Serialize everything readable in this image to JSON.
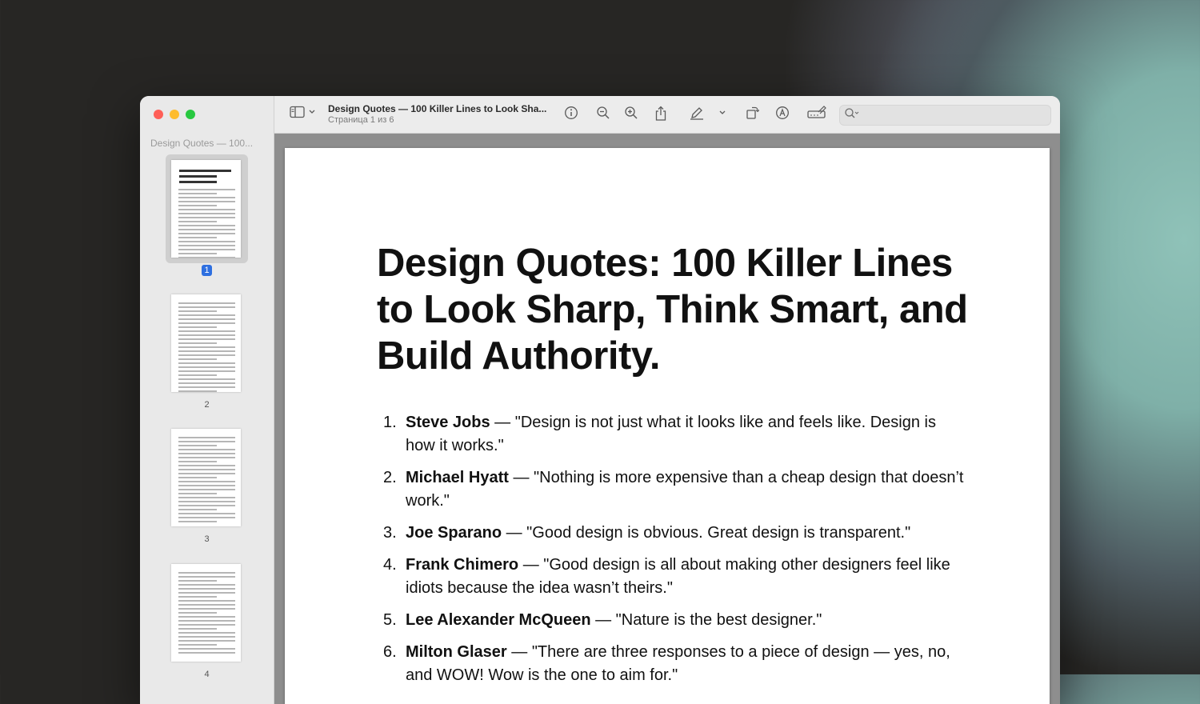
{
  "window": {
    "sidebar_title": "Design Quotes — 100...",
    "toolbar": {
      "doc_title": "Design Quotes — 100 Killer Lines to Look Sha...",
      "page_indicator": "Страница 1 из 6"
    }
  },
  "thumbnails": [
    {
      "label": "1",
      "selected": true
    },
    {
      "label": "2",
      "selected": false
    },
    {
      "label": "3",
      "selected": false
    },
    {
      "label": "4",
      "selected": false
    }
  ],
  "document": {
    "title": "Design Quotes: 100 Killer Lines to Look Sharp, Think Smart, and Build Authority.",
    "quotes": [
      {
        "num": "1.",
        "author": "Steve Jobs",
        "text": " — \"Design is not just what it looks like and feels like. Design is how it works.\""
      },
      {
        "num": "2.",
        "author": "Michael Hyatt",
        "text": " — \"Nothing is more expensive than a cheap design that doesn’t work.\""
      },
      {
        "num": "3.",
        "author": "Joe Sparano",
        "text": " — \"Good design is obvious. Great design is transparent.\""
      },
      {
        "num": "4.",
        "author": "Frank Chimero",
        "text": " — \"Good design is all about making other designers feel like idiots because the idea wasn’t theirs.\""
      },
      {
        "num": "5.",
        "author": "Lee Alexander McQueen",
        "text": " — \"Nature is the best designer.\""
      },
      {
        "num": "6.",
        "author": "Milton Glaser",
        "text": " — \"There are three responses to a piece of design — yes, no, and WOW! Wow is the one to aim for.\""
      }
    ]
  },
  "icons": [
    "sidebar-toggle-icon",
    "info-icon",
    "zoom-out-icon",
    "zoom-in-icon",
    "share-icon",
    "markup-pen-icon",
    "rotate-icon",
    "annotate-icon",
    "form-fill-icon",
    "search-icon"
  ]
}
